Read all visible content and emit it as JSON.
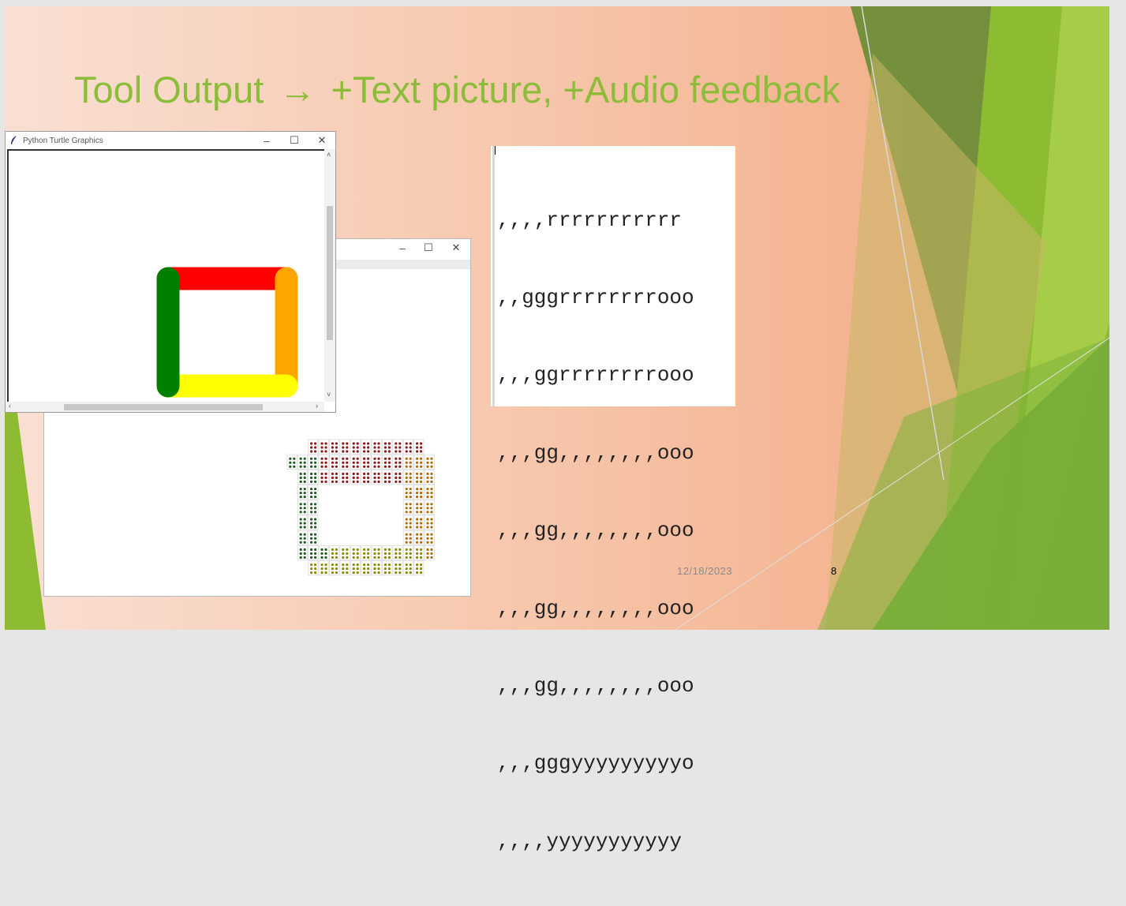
{
  "slide": {
    "title_left": "Tool Output",
    "title_arrow": "→",
    "title_right": "+Text picture, +Audio feedback",
    "date": "12/18/2023",
    "page_number": "8",
    "theme_colors": {
      "green_light": "#8cbd3a",
      "green_dark": "#5a8a2a",
      "background": "#f5c4a6"
    }
  },
  "turtle_window": {
    "title": "Python Turtle Graphics",
    "app_icon": "feather-icon",
    "controls": [
      "minimize-icon",
      "maximize-icon",
      "close-icon"
    ],
    "shape_colors": {
      "top": "#ff0000",
      "right": "#ffa500",
      "bottom": "#ffff00",
      "left": "#008000"
    }
  },
  "braille_window": {
    "controls": [
      "minimize-icon",
      "maximize-icon",
      "close-icon"
    ],
    "dot_colors": {
      "red": "#8b1a1a",
      "green": "#1f5a1f",
      "orange": "#b36b00",
      "yellow": "#8a8a00"
    }
  },
  "text_picture": {
    "lines": [
      ",,,,rrrrrrrrrrr",
      ",,gggrrrrrrrrooo",
      ",,,ggrrrrrrrrooo",
      ",,,gg,,,,,,,,ooo",
      ",,,gg,,,,,,,,ooo",
      ",,,gg,,,,,,,,ooo",
      ",,,gg,,,,,,,,ooo",
      ",,,gggyyyyyyyyyo",
      ",,,,yyyyyyyyyyy"
    ]
  }
}
